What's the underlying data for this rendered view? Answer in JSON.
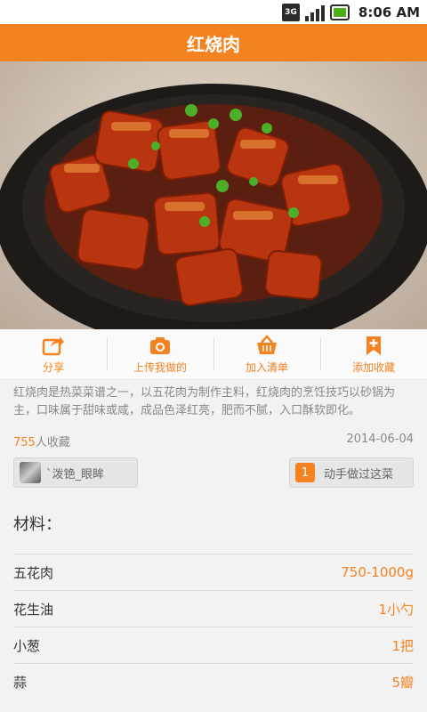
{
  "status_bar": {
    "network": "3G",
    "time": "8:06 AM"
  },
  "title": "红烧肉",
  "hero": {
    "image": "braised-pork-dish-photo"
  },
  "actions": [
    {
      "label": "分享",
      "icon": "share-icon"
    },
    {
      "label": "上传我做的",
      "icon": "camera-icon"
    },
    {
      "label": "加入清单",
      "icon": "basket-icon"
    },
    {
      "label": "添加收藏",
      "icon": "bookmark-add-icon"
    }
  ],
  "description": "红烧肉是热菜菜谱之一，以五花肉为制作主料，红烧肉的烹饪技巧以砂锅为主，口味属于甜味或咸，成品色泽红亮，肥而不腻，入口酥软即化。",
  "favorites": {
    "count": "755",
    "suffix": "人收藏"
  },
  "date": "2014-06-04",
  "author": {
    "name": "`泼铯_眼眸"
  },
  "done": {
    "count": "1",
    "label": "动手做过这菜"
  },
  "materials_title": "材料：",
  "ingredients": [
    {
      "name": "五花肉",
      "qty": "750-1000g"
    },
    {
      "name": "花生油",
      "qty": "1小勺"
    },
    {
      "name": "小葱",
      "qty": "1把"
    },
    {
      "name": "蒜",
      "qty": "5瓣"
    }
  ],
  "colors": {
    "accent": "#f58220",
    "text_muted": "#888888"
  }
}
